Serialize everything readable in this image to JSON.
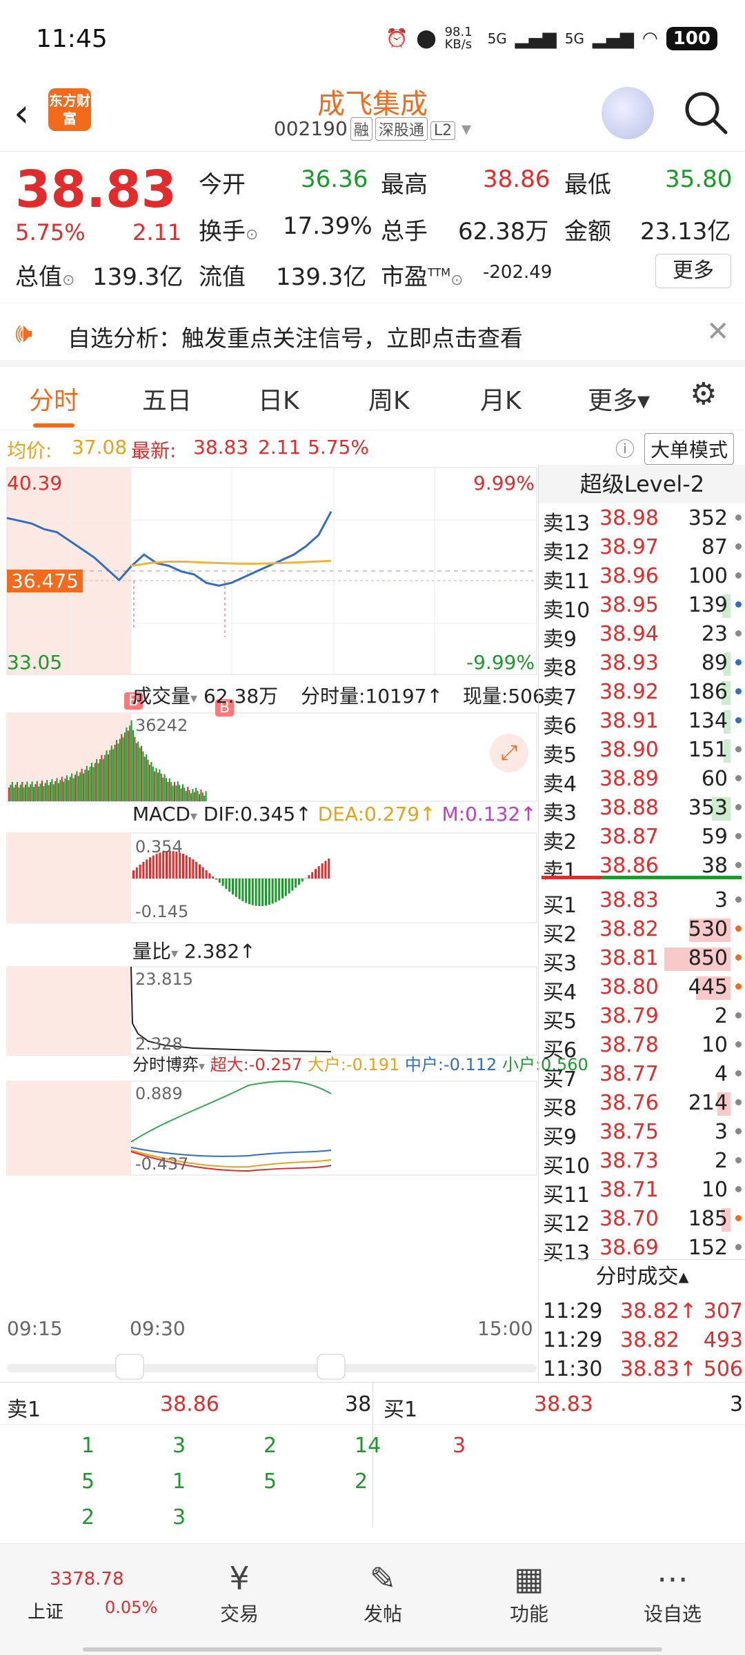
{
  "status": {
    "time": "11:45",
    "net_speed": "98.1 KB/s",
    "net1": "5G",
    "net2": "5G",
    "battery": "100"
  },
  "header": {
    "logo_text": "东方财富",
    "title": "成飞集成",
    "code": "002190",
    "tags": [
      "融",
      "深股通",
      "L2"
    ]
  },
  "quote": {
    "price": "38.83",
    "change_pct": "5.75%",
    "change": "2.11",
    "open_label": "今开",
    "open": "36.36",
    "high_label": "最高",
    "high": "38.86",
    "low_label": "最低",
    "low": "35.80",
    "turnover_label": "换手",
    "turnover": "17.39%",
    "volume_label": "总手",
    "volume": "62.38万",
    "amount_label": "金额",
    "amount": "23.13亿",
    "mktcap_label": "总值",
    "mktcap": "139.3亿",
    "float_label": "流值",
    "float": "139.3亿",
    "pe_label": "市盈",
    "pe_sup": "TTM",
    "pe": "-202.49",
    "more": "更多"
  },
  "notice": {
    "text": "自选分析：触发重点关注信号，立即点击查看",
    "close": "✕"
  },
  "tabs": [
    "分时",
    "五日",
    "日K",
    "周K",
    "月K",
    "更多▾"
  ],
  "infobar": {
    "avg_label": "均价:",
    "avg": "37.08",
    "latest_label": "最新:",
    "latest": "38.83",
    "change": "2.11",
    "pct": "5.75%",
    "big_mode": "大单模式"
  },
  "chart": {
    "ymax": "40.39",
    "ymin": "33.05",
    "pct_max": "9.99%",
    "pct_min": "-9.99%",
    "cursor_price": "36.475",
    "marker": "B",
    "vol_label": "成交量",
    "vol_total": "62.38万",
    "vol_tick": "分时量:10197↑",
    "vol_now": "现量:506",
    "vol_max": "36242",
    "macd_label": "MACD",
    "dif": "DIF:0.345↑",
    "dea": "DEA:0.279↑",
    "m": "M:0.132↑",
    "macd_top": "0.354",
    "macd_bot": "-0.145",
    "lb_label": "量比",
    "lb_value": "2.382↑",
    "lb_top": "23.815",
    "lb_bot": "2.328",
    "game_label": "分时博弈",
    "super": "超大:-0.257",
    "big": "大户:-0.191",
    "mid": "中户:-0.112",
    "small": "小户:0.560",
    "game_top": "0.889",
    "game_bot": "-0.437",
    "t_start": "09:15",
    "t_open": "09:30",
    "t_end": "15:00",
    "colors": {
      "price_line": "#2e6fc4",
      "avg_line": "#f0b43c",
      "up": "#e22c2c",
      "down": "#1a9a2a"
    }
  },
  "chart_data": {
    "type": "line",
    "title": "",
    "xlabel": "",
    "ylabel": "",
    "ylim": [
      33.05,
      40.39
    ],
    "x_ticks": [
      "09:15",
      "09:30",
      "15:00"
    ],
    "series": [
      {
        "values": [
          38.6,
          38.5,
          38.4,
          38.2,
          38.1,
          37.8,
          37.5,
          37.2,
          36.8,
          36.4,
          36.9,
          37.3,
          37.0,
          36.9,
          36.7,
          36.6,
          36.3,
          36.2,
          36.3,
          36.5,
          36.7,
          36.9,
          37.1,
          37.3,
          37.6,
          38.0,
          38.83
        ]
      },
      {
        "values": [
          36.9,
          37.0,
          37.05,
          37.05,
          37.02,
          37.0,
          36.98,
          36.98,
          37.0,
          37.02,
          37.05,
          37.08
        ]
      }
    ]
  },
  "book": {
    "title": "超级Level-2",
    "asks": [
      {
        "k": "卖13",
        "p": "38.98",
        "v": "352",
        "dot": "#888",
        "bar": 0
      },
      {
        "k": "卖12",
        "p": "38.97",
        "v": "87",
        "dot": "#888",
        "bar": 0
      },
      {
        "k": "卖11",
        "p": "38.96",
        "v": "100",
        "dot": "#888",
        "bar": 0
      },
      {
        "k": "卖10",
        "p": "38.95",
        "v": "139",
        "dot": "#2e6fc4",
        "bar": 12
      },
      {
        "k": "卖9",
        "p": "38.94",
        "v": "23",
        "dot": "#888",
        "bar": 0
      },
      {
        "k": "卖8",
        "p": "38.93",
        "v": "89",
        "dot": "#2e6fc4",
        "bar": 10
      },
      {
        "k": "卖7",
        "p": "38.92",
        "v": "186",
        "dot": "#2e6fc4",
        "bar": 14
      },
      {
        "k": "卖6",
        "p": "38.91",
        "v": "134",
        "dot": "#2e6fc4",
        "bar": 10
      },
      {
        "k": "卖5",
        "p": "38.90",
        "v": "151",
        "dot": "#888",
        "bar": 10
      },
      {
        "k": "卖4",
        "p": "38.89",
        "v": "60",
        "dot": "#888",
        "bar": 0
      },
      {
        "k": "卖3",
        "p": "38.88",
        "v": "353",
        "dot": "#888",
        "bar": 28
      },
      {
        "k": "卖2",
        "p": "38.87",
        "v": "59",
        "dot": "#888",
        "bar": 0
      },
      {
        "k": "卖1",
        "p": "38.86",
        "v": "38",
        "dot": "#888",
        "bar": 0
      }
    ],
    "bids": [
      {
        "k": "买1",
        "p": "38.83",
        "v": "3",
        "dot": "#888",
        "bar": 0
      },
      {
        "k": "买2",
        "p": "38.82",
        "v": "530",
        "dot": "#f26b1d",
        "bar": 62
      },
      {
        "k": "买3",
        "p": "38.81",
        "v": "850",
        "dot": "#f26b1d",
        "bar": 100
      },
      {
        "k": "买4",
        "p": "38.80",
        "v": "445",
        "dot": "#f26b1d",
        "bar": 52
      },
      {
        "k": "买5",
        "p": "38.79",
        "v": "2",
        "dot": "#888",
        "bar": 0
      },
      {
        "k": "买6",
        "p": "38.78",
        "v": "10",
        "dot": "#888",
        "bar": 0
      },
      {
        "k": "买7",
        "p": "38.77",
        "v": "4",
        "dot": "#888",
        "bar": 0
      },
      {
        "k": "买8",
        "p": "38.76",
        "v": "214",
        "dot": "#888",
        "bar": 20
      },
      {
        "k": "买9",
        "p": "38.75",
        "v": "3",
        "dot": "#888",
        "bar": 0
      },
      {
        "k": "买10",
        "p": "38.73",
        "v": "2",
        "dot": "#888",
        "bar": 0
      },
      {
        "k": "买11",
        "p": "38.71",
        "v": "10",
        "dot": "#888",
        "bar": 0
      },
      {
        "k": "买12",
        "p": "38.70",
        "v": "185",
        "dot": "#f26b1d",
        "bar": 14
      },
      {
        "k": "买13",
        "p": "38.69",
        "v": "152",
        "dot": "#888",
        "bar": 0
      }
    ],
    "trades_title": "分时成交▴",
    "trades": [
      {
        "t": "11:29",
        "p": "38.82↑",
        "v": "307"
      },
      {
        "t": "11:29",
        "p": "38.82",
        "v": "493"
      },
      {
        "t": "11:30",
        "p": "38.83↑",
        "v": "506"
      }
    ]
  },
  "lower": {
    "sell_label": "卖1",
    "sell_price": "38.86",
    "sell_vol": "38",
    "buy_label": "买1",
    "buy_price": "38.83",
    "buy_vol": "3",
    "sell_grid": [
      [
        "1",
        "3",
        "2",
        "14"
      ],
      [
        "5",
        "1",
        "5",
        "2"
      ],
      [
        "2",
        "3",
        "",
        ""
      ]
    ],
    "buy_grid": [
      [
        "3"
      ]
    ]
  },
  "bottom": {
    "index_value": "3378.78",
    "index_name": "上证",
    "index_pct": "0.05%",
    "nav": [
      "交易",
      "发帖",
      "功能",
      "设自选"
    ]
  }
}
